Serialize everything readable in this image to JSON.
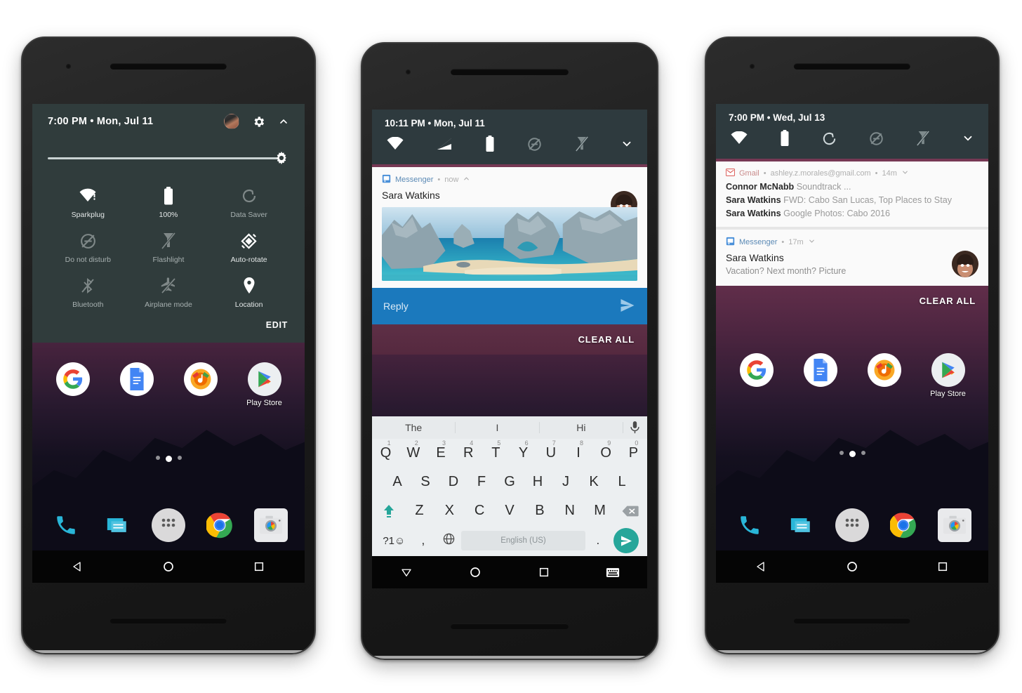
{
  "phone1": {
    "quick_settings": {
      "time": "7:00 PM • Mon, Jul 11",
      "avatar_name": "user-avatar",
      "settings_icon": "gear-icon",
      "collapse_icon": "chevron-up-icon",
      "brightness_icon": "brightness-gear-icon",
      "brightness_percent": 100,
      "edit_label": "EDIT",
      "tiles": [
        {
          "label": "Sparkplug",
          "icon": "wifi-icon",
          "active": true
        },
        {
          "label": "100%",
          "icon": "battery-icon",
          "active": true
        },
        {
          "label": "Data Saver",
          "icon": "data-saver-icon",
          "active": false
        },
        {
          "label": "Do not disturb",
          "icon": "do-not-disturb-icon",
          "active": false
        },
        {
          "label": "Flashlight",
          "icon": "flashlight-off-icon",
          "active": false
        },
        {
          "label": "Auto-rotate",
          "icon": "auto-rotate-icon",
          "active": true
        },
        {
          "label": "Bluetooth",
          "icon": "bluetooth-off-icon",
          "active": false
        },
        {
          "label": "Airplane mode",
          "icon": "airplane-off-icon",
          "active": false
        },
        {
          "label": "Location",
          "icon": "location-pin-icon",
          "active": true
        }
      ]
    },
    "home": {
      "apps": [
        {
          "label": "",
          "icon": "google-icon"
        },
        {
          "label": "",
          "icon": "docs-icon"
        },
        {
          "label": "",
          "icon": "play-music-icon"
        },
        {
          "label": "Play Store",
          "icon": "play-store-icon"
        }
      ],
      "page_dots": 3,
      "active_dot": 1,
      "dock": [
        {
          "icon": "phone-icon"
        },
        {
          "icon": "messages-icon"
        },
        {
          "icon": "all-apps-icon"
        },
        {
          "icon": "chrome-icon"
        },
        {
          "icon": "camera-icon"
        }
      ]
    },
    "navbar": [
      {
        "icon": "back-icon"
      },
      {
        "icon": "home-icon"
      },
      {
        "icon": "recents-icon"
      }
    ]
  },
  "phone2": {
    "status_bar": {
      "time": "10:11 PM • Mon, Jul 11",
      "icons": [
        "wifi-icon",
        "signal-icon",
        "battery-icon",
        "do-not-disturb-icon",
        "flashlight-off-icon",
        "chevron-down-icon"
      ]
    },
    "notification": {
      "app": "Messenger",
      "separator": "•",
      "time": "now",
      "expand_icon": "chevron-up-icon",
      "title": "Sara Watkins",
      "avatar_name": "sara-watkins-avatar",
      "image_name": "cabo-san-lucas-photo",
      "reply_placeholder": "Reply",
      "send_icon": "send-icon"
    },
    "clear_all_label": "CLEAR ALL",
    "keyboard": {
      "suggestions": [
        "The",
        "I",
        "Hi"
      ],
      "mic_icon": "microphone-icon",
      "row1": [
        {
          "key": "Q",
          "num": "1"
        },
        {
          "key": "W",
          "num": "2"
        },
        {
          "key": "E",
          "num": "3"
        },
        {
          "key": "R",
          "num": "4"
        },
        {
          "key": "T",
          "num": "5"
        },
        {
          "key": "Y",
          "num": "6"
        },
        {
          "key": "U",
          "num": "7"
        },
        {
          "key": "I",
          "num": "8"
        },
        {
          "key": "O",
          "num": "9"
        },
        {
          "key": "P",
          "num": "0"
        }
      ],
      "row2": [
        "A",
        "S",
        "D",
        "F",
        "G",
        "H",
        "J",
        "K",
        "L"
      ],
      "row3": [
        "Z",
        "X",
        "C",
        "V",
        "B",
        "N",
        "M"
      ],
      "shift_icon": "shift-icon",
      "backspace_icon": "backspace-icon",
      "symbols_label": "?1☺",
      "comma_label": ",",
      "globe_icon": "language-globe-icon",
      "spacebar_label": "English (US)",
      "period_label": ".",
      "send_icon": "send-icon"
    },
    "navbar": [
      {
        "icon": "keyboard-down-icon"
      },
      {
        "icon": "home-icon"
      },
      {
        "icon": "recents-icon"
      },
      {
        "icon": "keyboard-switch-icon"
      }
    ]
  },
  "phone3": {
    "status_bar": {
      "time": "7:00 PM • Wed, Jul 13",
      "icons": [
        "wifi-icon",
        "battery-icon",
        "data-saver-icon",
        "do-not-disturb-icon",
        "flashlight-off-icon",
        "chevron-down-icon"
      ]
    },
    "notifications": [
      {
        "app": "Gmail",
        "account": "ashley.z.morales@gmail.com",
        "time": "14m",
        "expand_icon": "chevron-down-icon",
        "rows": [
          {
            "sender": "Connor McNabb",
            "subject": "Soundtrack ..."
          },
          {
            "sender": "Sara Watkins",
            "subject": "FWD: Cabo San Lucas, Top Places to Stay"
          },
          {
            "sender": "Sara Watkins",
            "subject": "Google Photos: Cabo 2016"
          }
        ]
      },
      {
        "app": "Messenger",
        "time": "17m",
        "expand_icon": "chevron-down-icon",
        "title": "Sara Watkins",
        "subtitle": "Vacation? Next month?  Picture",
        "avatar_name": "sara-watkins-avatar"
      }
    ],
    "clear_all_label": "CLEAR ALL",
    "home": {
      "apps": [
        {
          "label": "",
          "icon": "google-icon"
        },
        {
          "label": "",
          "icon": "docs-icon"
        },
        {
          "label": "",
          "icon": "play-music-icon"
        },
        {
          "label": "Play Store",
          "icon": "play-store-icon"
        }
      ],
      "page_dots": 3,
      "active_dot": 1,
      "dock": [
        {
          "icon": "phone-icon"
        },
        {
          "icon": "messages-icon"
        },
        {
          "icon": "all-apps-icon"
        },
        {
          "icon": "chrome-icon"
        },
        {
          "icon": "camera-icon"
        }
      ]
    },
    "navbar": [
      {
        "icon": "back-icon"
      },
      {
        "icon": "home-icon"
      },
      {
        "icon": "recents-icon"
      }
    ]
  },
  "colors": {
    "qs_bg": "#303c3c",
    "status_bg": "#2e3a3e",
    "notif_bg": "#fafafa",
    "reply_blue": "#1b79bd",
    "messenger_blue": "#5b8ab5",
    "gmail_red": "#c98b8b",
    "send_teal": "#26a69a"
  }
}
